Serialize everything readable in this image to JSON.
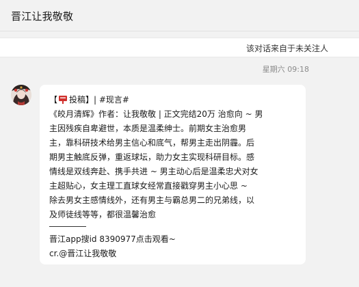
{
  "header": {
    "title": "晋江让我敬敬"
  },
  "notice": {
    "text": "该对话来自于未关注人"
  },
  "chat": {
    "timestamp": "星期六 09:18",
    "message": {
      "tag_open": "【",
      "tag_label": "投稿】| #现言#",
      "lines": [
        "《皎月清辉》作者：让我敬敬 | 正文完结20万 治愈向 ~ 男",
        "主因残疾自卑避世，本质是温柔绅士。前期女主治愈男",
        "主，靠科研技术给男主信心和底气，帮男主走出阴霾。后",
        "期男主触底反弹，重返球坛，助力女主实现科研目标。感",
        "情线是双线奔赴、携手共进 ~ 男主动心后是温柔忠犬对女",
        "主超贴心，女主理工直球女经常直接戳穿男主小心思 ~",
        "除去男女主感情线外，还有男主与霸总男二的兄弟线，以",
        "及师徒线等等，都很温馨治愈"
      ],
      "footer_lines": [
        "晋江app搜id 8390977点击观看~",
        "cr.@晋江让我敬敬"
      ]
    }
  },
  "icons": {
    "tag": "red-mailbox-icon",
    "avatar": "user-avatar"
  },
  "colors": {
    "background": "#f2f2f2",
    "bubble": "#ffffff",
    "tag_icon": "#d0312d",
    "timestamp": "#8a8a8a"
  }
}
